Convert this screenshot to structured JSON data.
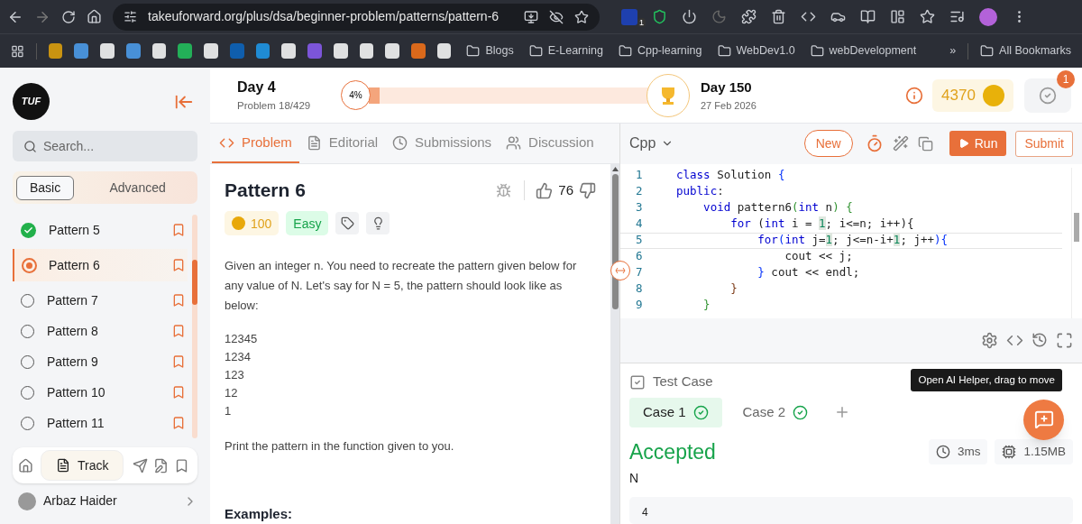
{
  "browser": {
    "url": "takeuforward.org/plus/dsa/beginner-problem/patterns/pattern-6",
    "extension_badge": "1",
    "bookmarks": [
      "Blogs",
      "E-Learning",
      "Cpp-learning",
      "WebDev1.0",
      "webDevelopment"
    ],
    "more": "»",
    "all_bookmarks": "All Bookmarks"
  },
  "sidebar": {
    "logo": "TUF",
    "search": {
      "placeholder": "Search..."
    },
    "modes": [
      {
        "label": "Basic",
        "selected": true
      },
      {
        "label": "Advanced",
        "selected": false
      }
    ],
    "items": [
      {
        "label": "Pattern 5",
        "kind": "done",
        "selected": false
      },
      {
        "label": "Pattern 6",
        "kind": "current",
        "selected": true
      },
      {
        "label": "Pattern 7",
        "kind": "todo",
        "selected": false
      },
      {
        "label": "Pattern 8",
        "kind": "todo",
        "selected": false
      },
      {
        "label": "Pattern 9",
        "kind": "todo",
        "selected": false
      },
      {
        "label": "Pattern 10",
        "kind": "todo",
        "selected": false
      },
      {
        "label": "Pattern 11",
        "kind": "todo",
        "selected": false
      }
    ],
    "track": "Track",
    "user": "Arbaz Haider"
  },
  "header": {
    "day": "Day 4",
    "problem": "Problem 18/429",
    "progress": {
      "label": "4%",
      "level": 0.04
    },
    "goal_day": "Day 150",
    "goal_date": "27 Feb 2026",
    "coins": "4370",
    "notifications": "1"
  },
  "tabs": [
    {
      "label": "Problem",
      "selected": true
    },
    {
      "label": "Editorial",
      "selected": false
    },
    {
      "label": "Submissions",
      "selected": false
    },
    {
      "label": "Discussion",
      "selected": false
    }
  ],
  "problem": {
    "title": "Pattern 6",
    "likes": "76",
    "coins": "100",
    "difficulty": "Easy",
    "description": "Given an integer n. You need to recreate the pattern given below for any value of N. Let's say for N = 5, the pattern should look like as below:",
    "pattern": [
      "12345",
      "1234",
      "123",
      "12",
      "1"
    ],
    "instruction": "Print the pattern in the function given to you.",
    "examples": "Examples:"
  },
  "editor": {
    "language": "Cpp",
    "new": "New",
    "run": "Run",
    "submit": "Submit",
    "lines": [
      {
        "number": "1",
        "selected": false,
        "tokens": [
          {
            "text": "class",
            "kind": "keyword"
          },
          {
            "text": " Solution ",
            "kind": "plain"
          },
          {
            "text": "{",
            "kind": "bracket1"
          }
        ]
      },
      {
        "number": "2",
        "selected": false,
        "tokens": [
          {
            "text": "public",
            "kind": "keyword"
          },
          {
            "text": ":",
            "kind": "plain"
          }
        ]
      },
      {
        "number": "3",
        "selected": false,
        "tokens": [
          {
            "text": "    void",
            "kind": "keyword"
          },
          {
            "text": " pattern6",
            "kind": "plain"
          },
          {
            "text": "(",
            "kind": "bracket2"
          },
          {
            "text": "int",
            "kind": "keyword"
          },
          {
            "text": " n",
            "kind": "plain"
          },
          {
            "text": ") {",
            "kind": "bracket2"
          }
        ]
      },
      {
        "number": "4",
        "selected": false,
        "tokens": [
          {
            "text": "        for",
            "kind": "keyword"
          },
          {
            "text": " (",
            "kind": "plain"
          },
          {
            "text": "int",
            "kind": "keyword"
          },
          {
            "text": " i = ",
            "kind": "plain"
          },
          {
            "text": "1",
            "kind": "number"
          },
          {
            "text": "; i<=n; i++){",
            "kind": "plain"
          }
        ]
      },
      {
        "number": "5",
        "selected": true,
        "tokens": [
          {
            "text": "            for",
            "kind": "keyword"
          },
          {
            "text": "(",
            "kind": "bracket1"
          },
          {
            "text": "int",
            "kind": "keyword"
          },
          {
            "text": " j=",
            "kind": "plain"
          },
          {
            "text": "1",
            "kind": "number"
          },
          {
            "text": "; j<=n-i+",
            "kind": "plain"
          },
          {
            "text": "1",
            "kind": "number"
          },
          {
            "text": "; j++",
            "kind": "plain"
          },
          {
            "text": "){",
            "kind": "bracket1"
          }
        ]
      },
      {
        "number": "6",
        "selected": false,
        "tokens": [
          {
            "text": "                cout << j;",
            "kind": "plain"
          }
        ]
      },
      {
        "number": "7",
        "selected": false,
        "tokens": [
          {
            "text": "            }",
            "kind": "bracket1"
          },
          {
            "text": " cout << endl;",
            "kind": "plain"
          }
        ]
      },
      {
        "number": "8",
        "selected": false,
        "tokens": [
          {
            "text": "        }",
            "kind": "bracket3"
          }
        ]
      },
      {
        "number": "9",
        "selected": false,
        "tokens": [
          {
            "text": "    }",
            "kind": "bracket2"
          }
        ]
      }
    ]
  },
  "testcases": {
    "title": "Test Case",
    "cases": [
      {
        "label": "Case 1",
        "selected": true,
        "passed": true
      },
      {
        "label": "Case 2",
        "selected": false,
        "passed": true
      }
    ],
    "tooltip": "Open AI Helper, drag to move",
    "result": "Accepted",
    "time": "3ms",
    "memory": "1.15MB",
    "input_label": "N",
    "input_value": "4"
  }
}
